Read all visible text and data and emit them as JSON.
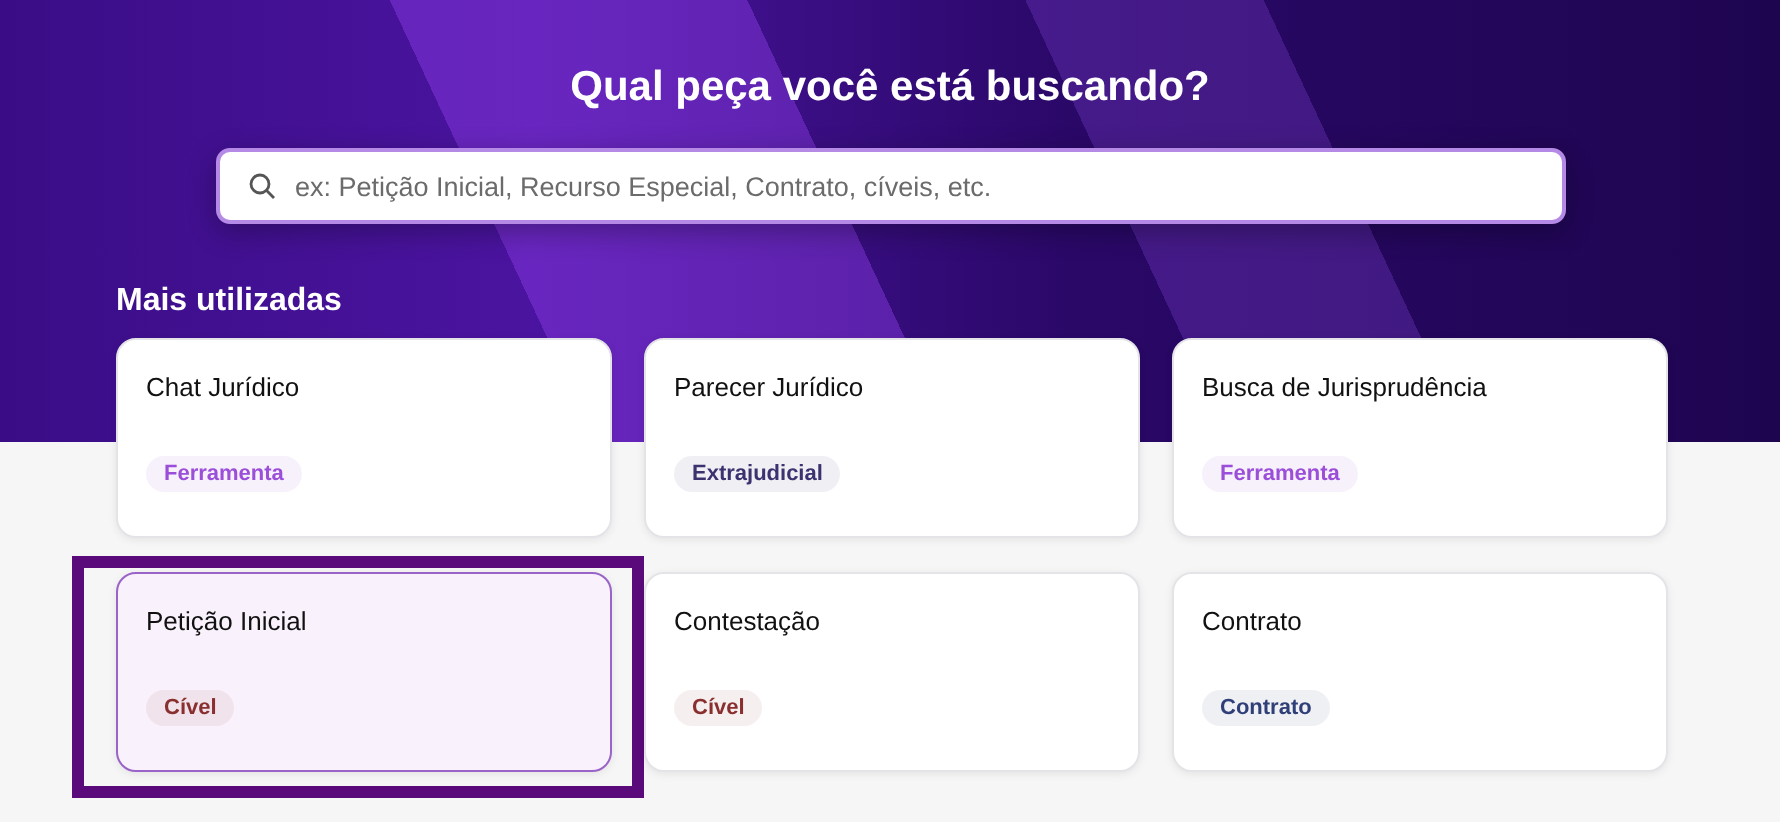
{
  "hero": {
    "title": "Qual peça você está buscando?"
  },
  "search": {
    "placeholder": "ex: Petição Inicial, Recurso Especial, Contrato, cíveis, etc."
  },
  "section_title": "Mais utilizadas",
  "cards": [
    {
      "title": "Chat Jurídico",
      "tag": "Ferramenta",
      "color": "#9b4fd9",
      "selected": false
    },
    {
      "title": "Parecer Jurídico",
      "tag": "Extrajudicial",
      "color": "#3d3270",
      "selected": false
    },
    {
      "title": "Busca de Jurisprudência",
      "tag": "Ferramenta",
      "color": "#9b4fd9",
      "selected": false
    },
    {
      "title": "Petição Inicial",
      "tag": "Cível",
      "color": "#8a2f2f",
      "selected": true
    },
    {
      "title": "Contestação",
      "tag": "Cível",
      "color": "#8a2f2f",
      "selected": false
    },
    {
      "title": "Contrato",
      "tag": "Contrato",
      "color": "#2f3f78",
      "selected": false
    }
  ]
}
